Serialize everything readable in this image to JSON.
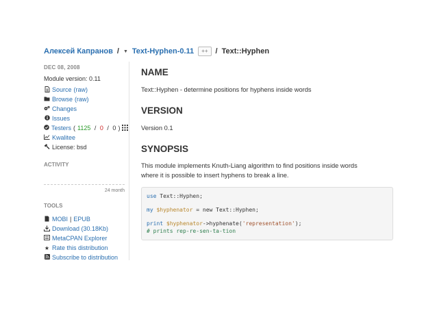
{
  "breadcrumb": {
    "author": "Алексей Капранов",
    "sep": "/",
    "distribution": "Text-Hyphen-0.11",
    "toggle_label": "++",
    "module": "Text::Hyphen"
  },
  "sidebar": {
    "date": "DEC 08, 2008",
    "module_version": "Module version: 0.11",
    "source": "Source",
    "source_raw": "(raw)",
    "browse": "Browse",
    "browse_raw": "(raw)",
    "changes": "Changes",
    "issues": "Issues",
    "testers_label": "Testers",
    "testers_pass": "1125",
    "testers_fail": "0",
    "testers_other": "0",
    "kwalitee": "Kwalitee",
    "license": "License: bsd",
    "activity_heading": "ACTIVITY",
    "activity_period": "24 month",
    "tools_heading": "TOOLS",
    "tools": {
      "mobi": "MOBI",
      "epub": "EPUB",
      "download": "Download (30.18Kb)",
      "explorer": "MetaCPAN Explorer",
      "rate": "Rate this distribution",
      "subscribe": "Subscribe to distribution"
    }
  },
  "content": {
    "name_heading": "NAME",
    "name_text": "Text::Hyphen - determine positions for hyphens inside words",
    "version_heading": "VERSION",
    "version_text": "Version 0.1",
    "synopsis_heading": "SYNOPSIS",
    "synopsis_line1": "This module implements Knuth-Liang algorithm to find positions inside words",
    "synopsis_line2": "where it is possible to insert hyphens to break a line.",
    "code": {
      "l1_kw": "use",
      "l1_rest": " Text::Hyphen;",
      "l2_kw": "my",
      "l2_var": " $hyphenator",
      "l2_rest": " = new Text::Hyphen;",
      "l3_kw": "print",
      "l3_var": " $hyphenator",
      "l3_mid": "->hyphenate(",
      "l3_str": "'representation'",
      "l3_end": ");",
      "l4_comment": "# prints rep-re-sen-ta-tion"
    }
  },
  "colors": {
    "link": "#2a6fb0",
    "pass": "#2a9a2a",
    "fail": "#cc2222",
    "code_bg": "#f5f5f5"
  },
  "icons": [
    "file-icon",
    "folder-icon",
    "cogs-icon",
    "info-icon",
    "check-circle-icon",
    "grid-icon",
    "line-chart-icon",
    "gavel-icon",
    "book-icon",
    "download-icon",
    "list-icon",
    "star-icon",
    "rss-icon"
  ]
}
